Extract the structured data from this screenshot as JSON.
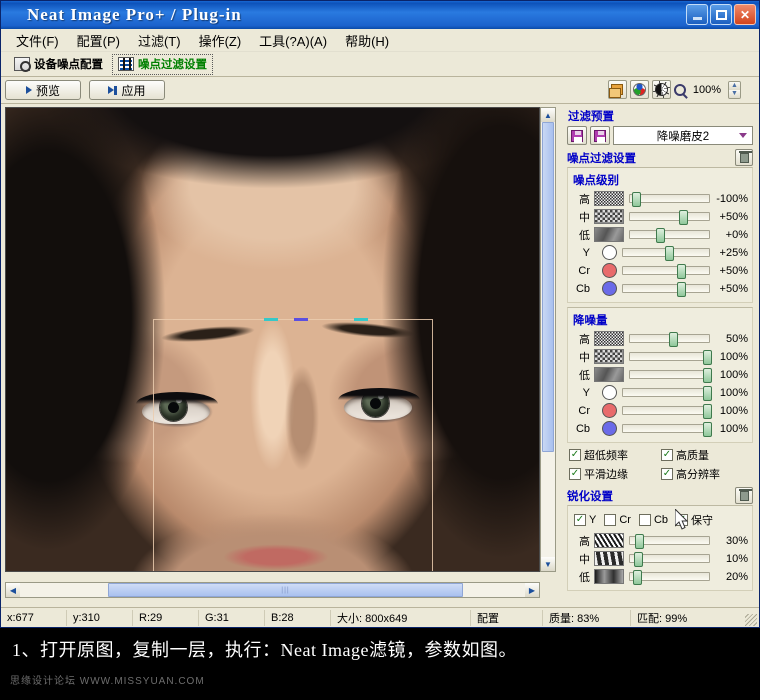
{
  "window": {
    "title": "Neat Image Pro+ / Plug-in",
    "app_icon": "flower-icon",
    "minimize_label": "Minimize",
    "maximize_label": "Maximize",
    "close_label": "Close"
  },
  "menubar": {
    "items": [
      {
        "label": "文件(F)"
      },
      {
        "label": "配置(P)"
      },
      {
        "label": "过滤(T)"
      },
      {
        "label": "操作(Z)"
      },
      {
        "label": "工具(?A)(A)"
      },
      {
        "label": "帮助(H)"
      }
    ]
  },
  "tabs": [
    {
      "label": "设备噪点配置",
      "active": false,
      "icon": "camera-icon"
    },
    {
      "label": "噪点过滤设置",
      "active": true,
      "icon": "levels-icon"
    }
  ],
  "toolbar": {
    "preview_label": "预览",
    "apply_label": "应用",
    "zoom_value": "100%",
    "icons": [
      "layers-icon",
      "rgb-channels-icon",
      "contrast-icon",
      "magnifier-icon"
    ]
  },
  "panel": {
    "preset": {
      "title": "过滤预置",
      "save_icon_1": "save-profile-icon",
      "save_icon_2": "save-preset-icon",
      "selected": "降噪磨皮2"
    },
    "noise_filter": {
      "title": "噪点过滤设置",
      "trash_label": "重置",
      "noise_levels": {
        "title": "噪点级别",
        "rows": [
          {
            "label": "高",
            "swatch": "noise-high",
            "value": "-100%",
            "pos": 2
          },
          {
            "label": "中",
            "swatch": "noise-mid",
            "value": "+50%",
            "pos": 62
          },
          {
            "label": "低",
            "swatch": "noise-low",
            "value": "+0%",
            "pos": 33
          },
          {
            "label": "Y",
            "swatch": "circle-y",
            "value": "+25%",
            "pos": 49
          },
          {
            "label": "Cr",
            "swatch": "circle-cr",
            "value": "+50%",
            "pos": 63
          },
          {
            "label": "Cb",
            "swatch": "circle-cb",
            "value": "+50%",
            "pos": 63
          }
        ]
      },
      "noise_amount": {
        "title": "降噪量",
        "rows": [
          {
            "label": "高",
            "swatch": "noise-high",
            "value": "50%",
            "pos": 49
          },
          {
            "label": "中",
            "swatch": "noise-mid",
            "value": "100%",
            "pos": 94
          },
          {
            "label": "低",
            "swatch": "noise-low",
            "value": "100%",
            "pos": 94
          },
          {
            "label": "Y",
            "swatch": "circle-y",
            "value": "100%",
            "pos": 94
          },
          {
            "label": "Cr",
            "swatch": "circle-cr",
            "value": "100%",
            "pos": 94
          },
          {
            "label": "Cb",
            "swatch": "circle-cb",
            "value": "100%",
            "pos": 94
          }
        ]
      },
      "options": [
        {
          "label": "超低频率",
          "checked": true
        },
        {
          "label": "高质量",
          "checked": true
        },
        {
          "label": "平滑边缘",
          "checked": true
        },
        {
          "label": "高分辨率",
          "checked": true
        }
      ]
    },
    "sharpening": {
      "title": "锐化设置",
      "trash_label": "重置",
      "channels": [
        {
          "label": "Y",
          "checked": true
        },
        {
          "label": "Cr",
          "checked": false
        },
        {
          "label": "Cb",
          "checked": false
        },
        {
          "label": "保守",
          "checked": true
        }
      ],
      "rows": [
        {
          "label": "高",
          "swatch": "sharp-high",
          "value": "30%",
          "pos": 6
        },
        {
          "label": "中",
          "swatch": "sharp-mid",
          "value": "10%",
          "pos": 5
        },
        {
          "label": "低",
          "swatch": "sharp-low",
          "value": "20%",
          "pos": 4
        }
      ]
    }
  },
  "statusbar": {
    "x": "x:677",
    "y": "y:310",
    "r": "R:29",
    "g": "G:31",
    "b": "B:28",
    "size": "大小: 800x649",
    "profile": "配置",
    "quality": "质量: 83%",
    "match": "匹配: 99%"
  },
  "caption": {
    "text": "1、打开原图，复制一层，执行：Neat Image滤镜，参数如图。",
    "watermark": "思缘设计论坛  WWW.MISSYUAN.COM"
  }
}
